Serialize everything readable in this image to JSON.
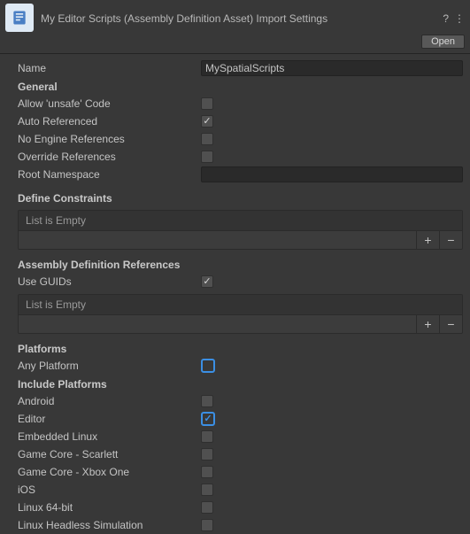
{
  "header": {
    "title": "My Editor Scripts (Assembly Definition Asset) Import Settings",
    "open_label": "Open"
  },
  "fields": {
    "name_label": "Name",
    "name_value": "MySpatialScripts",
    "general_label": "General",
    "allow_unsafe_label": "Allow 'unsafe' Code",
    "auto_referenced_label": "Auto Referenced",
    "no_engine_refs_label": "No Engine References",
    "override_refs_label": "Override References",
    "root_namespace_label": "Root Namespace",
    "root_namespace_value": ""
  },
  "define_constraints": {
    "title": "Define Constraints",
    "empty_text": "List is Empty"
  },
  "asm_refs": {
    "title": "Assembly Definition References",
    "use_guids_label": "Use GUIDs",
    "empty_text": "List is Empty"
  },
  "platforms": {
    "title": "Platforms",
    "any_platform_label": "Any Platform",
    "include_label": "Include Platforms",
    "items": [
      {
        "label": "Android",
        "checked": false
      },
      {
        "label": "Editor",
        "checked": true
      },
      {
        "label": "Embedded Linux",
        "checked": false
      },
      {
        "label": "Game Core - Scarlett",
        "checked": false
      },
      {
        "label": "Game Core - Xbox One",
        "checked": false
      },
      {
        "label": "iOS",
        "checked": false
      },
      {
        "label": "Linux 64-bit",
        "checked": false
      },
      {
        "label": "Linux Headless Simulation",
        "checked": false
      }
    ]
  }
}
